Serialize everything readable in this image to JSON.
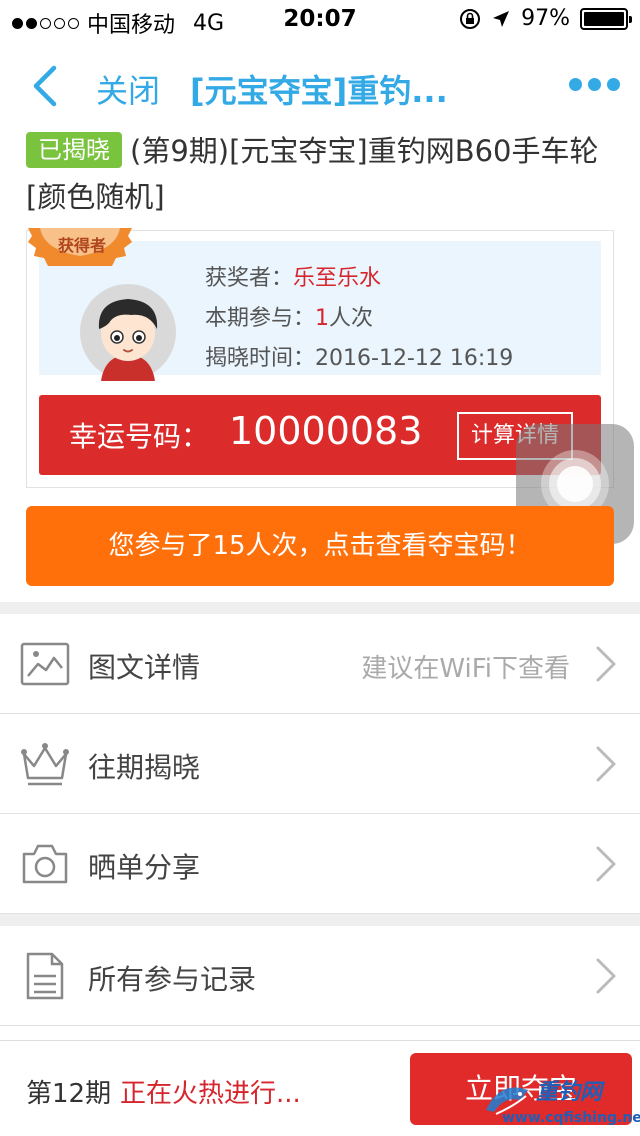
{
  "status_bar": {
    "carrier": "中国移动",
    "network": "4G",
    "time": "20:07",
    "battery": "97%",
    "battery_level": 0.97
  },
  "nav": {
    "close_label": "关闭",
    "title": "[元宝夺宝]重钓...",
    "accent_color": "#33a9e6"
  },
  "product": {
    "status_tag": "已揭晓",
    "title": "(第9期)[元宝夺宝]重钓网B60手车轮[颜色随机]"
  },
  "winner": {
    "badge": "获得者",
    "winner_label": "获奖者：",
    "winner_name": "乐至乐水",
    "participation_label": "本期参与：",
    "participation_count": "1",
    "participation_unit": "人次",
    "reveal_time_label": "揭晓时间：",
    "reveal_time": "2016-12-12 16:19",
    "lucky_label": "幸运号码：",
    "lucky_number": "10000083",
    "calc_details": "计算详情"
  },
  "participated_button": "您参与了15人次，点击查看夺宝码！",
  "menu": {
    "items": [
      {
        "label": "图文详情",
        "hint": "建议在WiFi下查看",
        "icon": "image-icon"
      },
      {
        "label": "往期揭晓",
        "hint": "",
        "icon": "crown-icon"
      },
      {
        "label": "晒单分享",
        "hint": "",
        "icon": "camera-icon"
      },
      {
        "label": "所有参与记录",
        "hint": "",
        "icon": "document-icon"
      }
    ]
  },
  "bottom": {
    "period": "第12期",
    "status": "正在火热进行...",
    "buy_button": "立即夺宝",
    "watermark_text": "重钓网",
    "watermark_url": "www.cqfishing.net"
  }
}
